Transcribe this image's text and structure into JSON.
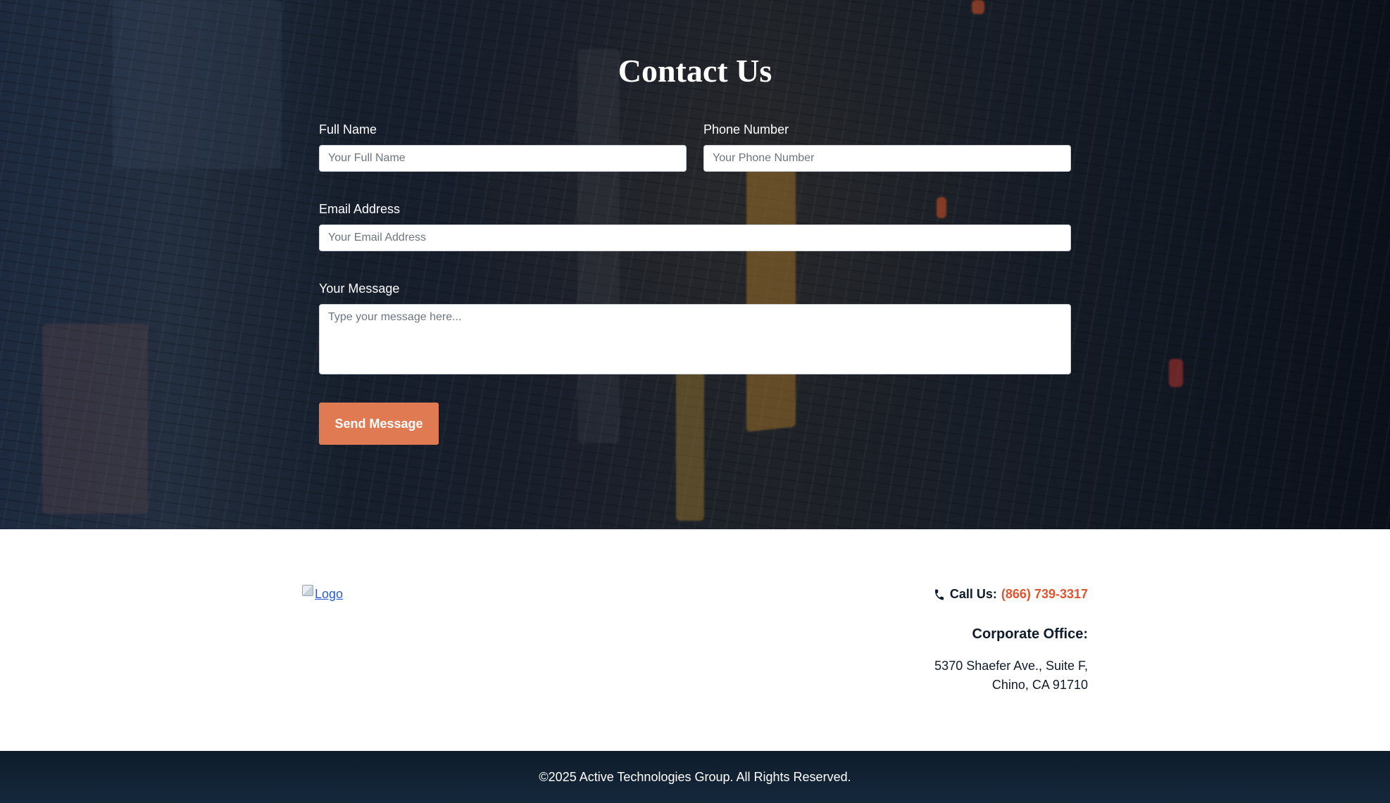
{
  "contact": {
    "title": "Contact Us",
    "full_name": {
      "label": "Full Name",
      "placeholder": "Your Full Name",
      "value": ""
    },
    "phone": {
      "label": "Phone Number",
      "placeholder": "Your Phone Number",
      "value": ""
    },
    "email": {
      "label": "Email Address",
      "placeholder": "Your Email Address",
      "value": ""
    },
    "message": {
      "label": "Your Message",
      "placeholder": "Type your message here...",
      "value": ""
    },
    "send_label": "Send Message"
  },
  "info": {
    "logo_alt": "Logo",
    "call_label": "Call Us:",
    "phone_number": "(866) 739-3317",
    "phone_icon": "phone-icon",
    "office_heading": "Corporate Office:",
    "address_line1": "5370 Shaefer Ave., Suite F,",
    "address_line2": "Chino, CA 91710"
  },
  "footer": {
    "copyright": "©2025 Active Technologies Group. All Rights Reserved."
  },
  "colors": {
    "accent_button": "#e07a52",
    "phone_link": "#e0542e",
    "footer_bg": "#0e1c2c",
    "heading_text": "#0f1b2a"
  }
}
